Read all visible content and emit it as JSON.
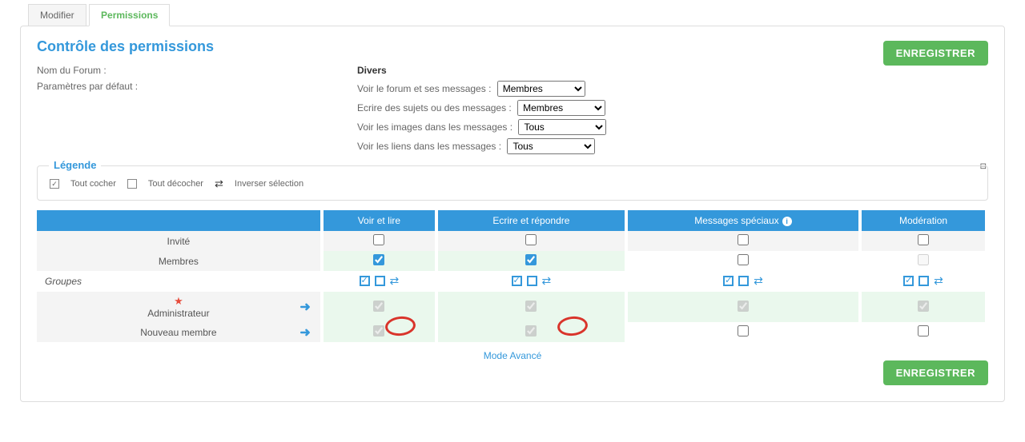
{
  "tabs": {
    "modifier": "Modifier",
    "permissions": "Permissions"
  },
  "panel": {
    "title": "Contrôle des permissions",
    "save_btn": "ENREGISTRER"
  },
  "form": {
    "forum_name_label": "Nom du Forum :",
    "forum_name_value": "Divers",
    "defaults_label": "Paramètres par défaut :",
    "settings": [
      {
        "label": "Voir le forum et ses messages :",
        "value": "Membres"
      },
      {
        "label": "Ecrire des sujets ou des messages :",
        "value": "Membres"
      },
      {
        "label": "Voir les images dans les messages :",
        "value": "Tous"
      },
      {
        "label": "Voir les liens dans les messages :",
        "value": "Tous"
      }
    ]
  },
  "legend": {
    "title": "Légende",
    "check_all": "Tout cocher",
    "uncheck_all": "Tout décocher",
    "invert": "Inverser sélection"
  },
  "table": {
    "columns": [
      "Voir et lire",
      "Ecrire et répondre",
      "Messages spéciaux",
      "Modération"
    ],
    "rows": {
      "invite": "Invité",
      "membres": "Membres",
      "groupes": "Groupes",
      "admin": "Administrateur",
      "nouveau": "Nouveau membre"
    },
    "cells": {
      "invite": {
        "voir": false,
        "ecrire": false,
        "special": false,
        "mod": false
      },
      "membres": {
        "voir": true,
        "ecrire": true,
        "special": false,
        "mod": false
      },
      "admin": {
        "voir": true,
        "ecrire": true,
        "special": true,
        "mod": true,
        "locked": true
      },
      "nouveau": {
        "voir": true,
        "ecrire": true,
        "special": false,
        "mod": false,
        "first_two_locked": true
      }
    }
  },
  "mode_link": "Mode Avancé"
}
